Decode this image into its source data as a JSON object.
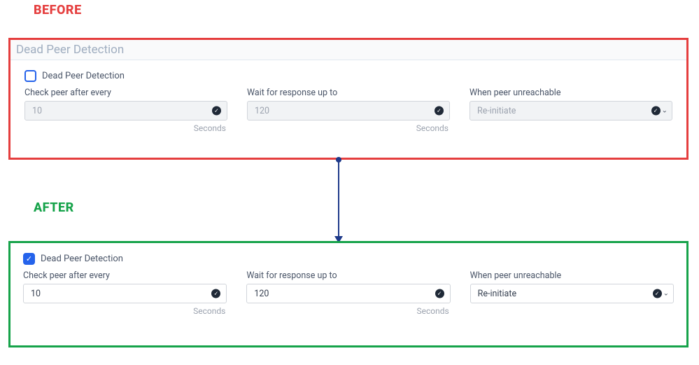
{
  "labels": {
    "before": "BEFORE",
    "after": "AFTER"
  },
  "before": {
    "section_title": "Dead Peer Detection",
    "checkbox_label": "Dead Peer Detection",
    "checked": false,
    "fields": {
      "check_peer": {
        "label": "Check peer after every",
        "value": "10",
        "unit": "Seconds"
      },
      "wait_resp": {
        "label": "Wait for response up to",
        "value": "120",
        "unit": "Seconds"
      },
      "unreach": {
        "label": "When peer unreachable",
        "value": "Re-initiate"
      }
    }
  },
  "after": {
    "checkbox_label": "Dead Peer Detection",
    "checked": true,
    "fields": {
      "check_peer": {
        "label": "Check peer after every",
        "value": "10",
        "unit": "Seconds"
      },
      "wait_resp": {
        "label": "Wait for response up to",
        "value": "120",
        "unit": "Seconds"
      },
      "unreach": {
        "label": "When peer unreachable",
        "value": "Re-initiate"
      }
    }
  }
}
